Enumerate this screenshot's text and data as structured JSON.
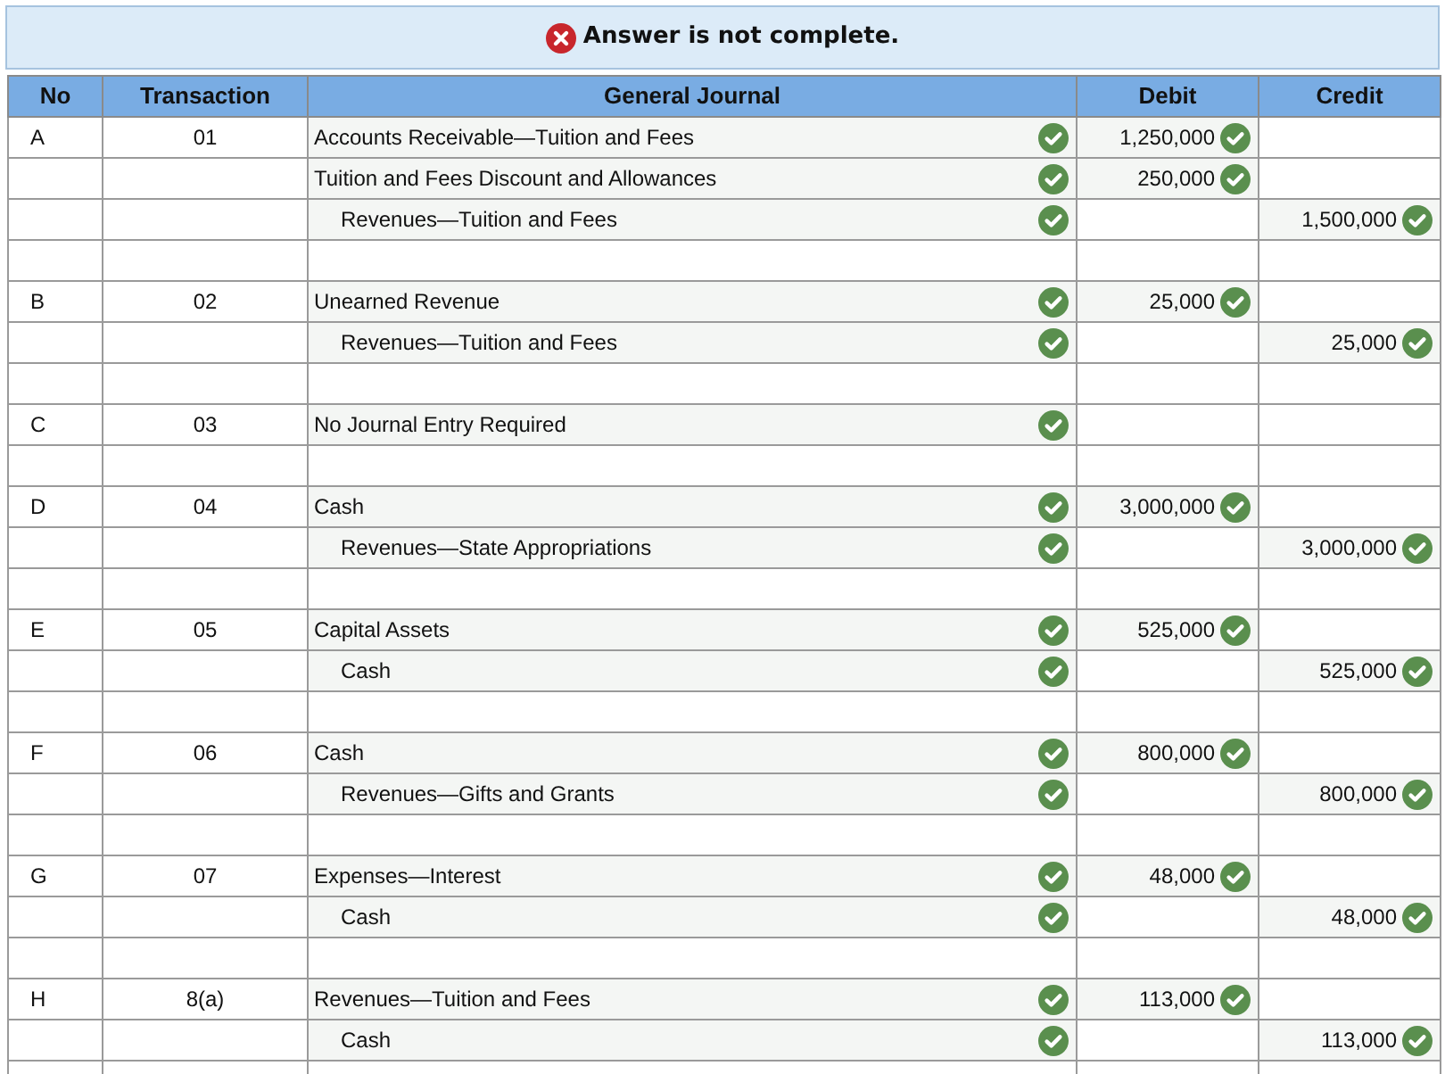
{
  "banner": {
    "text": "Answer is not complete.",
    "complete": false
  },
  "columns": [
    "No",
    "Transaction",
    "General Journal",
    "Debit",
    "Credit"
  ],
  "entries": [
    {
      "no": "A",
      "transaction": "01",
      "lines": [
        {
          "account": "Accounts Receivable—Tuition and Fees",
          "indented": false,
          "correct": true,
          "debit": {
            "value": "1,250,000",
            "correct": true
          }
        },
        {
          "account": "Tuition and Fees Discount and Allowances",
          "indented": false,
          "correct": true,
          "debit": {
            "value": "250,000",
            "correct": true
          }
        },
        {
          "account": "Revenues—Tuition and Fees",
          "indented": true,
          "correct": true,
          "credit": {
            "value": "1,500,000",
            "correct": true
          }
        }
      ]
    },
    {
      "no": "B",
      "transaction": "02",
      "lines": [
        {
          "account": "Unearned Revenue",
          "indented": false,
          "correct": true,
          "debit": {
            "value": "25,000",
            "correct": true
          }
        },
        {
          "account": "Revenues—Tuition and Fees",
          "indented": true,
          "correct": true,
          "credit": {
            "value": "25,000",
            "correct": true
          }
        }
      ]
    },
    {
      "no": "C",
      "transaction": "03",
      "lines": [
        {
          "account": "No Journal Entry Required",
          "indented": false,
          "correct": true
        }
      ]
    },
    {
      "no": "D",
      "transaction": "04",
      "lines": [
        {
          "account": "Cash",
          "indented": false,
          "correct": true,
          "debit": {
            "value": "3,000,000",
            "correct": true
          }
        },
        {
          "account": "Revenues—State Appropriations",
          "indented": true,
          "correct": true,
          "credit": {
            "value": "3,000,000",
            "correct": true
          }
        }
      ]
    },
    {
      "no": "E",
      "transaction": "05",
      "lines": [
        {
          "account": "Capital Assets",
          "indented": false,
          "correct": true,
          "debit": {
            "value": "525,000",
            "correct": true
          }
        },
        {
          "account": "Cash",
          "indented": true,
          "correct": true,
          "credit": {
            "value": "525,000",
            "correct": true
          }
        }
      ]
    },
    {
      "no": "F",
      "transaction": "06",
      "lines": [
        {
          "account": "Cash",
          "indented": false,
          "correct": true,
          "debit": {
            "value": "800,000",
            "correct": true
          }
        },
        {
          "account": "Revenues—Gifts and Grants",
          "indented": true,
          "correct": true,
          "credit": {
            "value": "800,000",
            "correct": true
          }
        }
      ]
    },
    {
      "no": "G",
      "transaction": "07",
      "lines": [
        {
          "account": "Expenses—Interest",
          "indented": false,
          "correct": true,
          "debit": {
            "value": "48,000",
            "correct": true
          }
        },
        {
          "account": "Cash",
          "indented": true,
          "correct": true,
          "credit": {
            "value": "48,000",
            "correct": true
          }
        }
      ]
    },
    {
      "no": "H",
      "transaction": "8(a)",
      "lines": [
        {
          "account": "Revenues—Tuition and Fees",
          "indented": false,
          "correct": true,
          "debit": {
            "value": "113,000",
            "correct": true
          }
        },
        {
          "account": "Cash",
          "indented": true,
          "correct": true,
          "credit": {
            "value": "113,000",
            "correct": true
          }
        }
      ]
    }
  ]
}
